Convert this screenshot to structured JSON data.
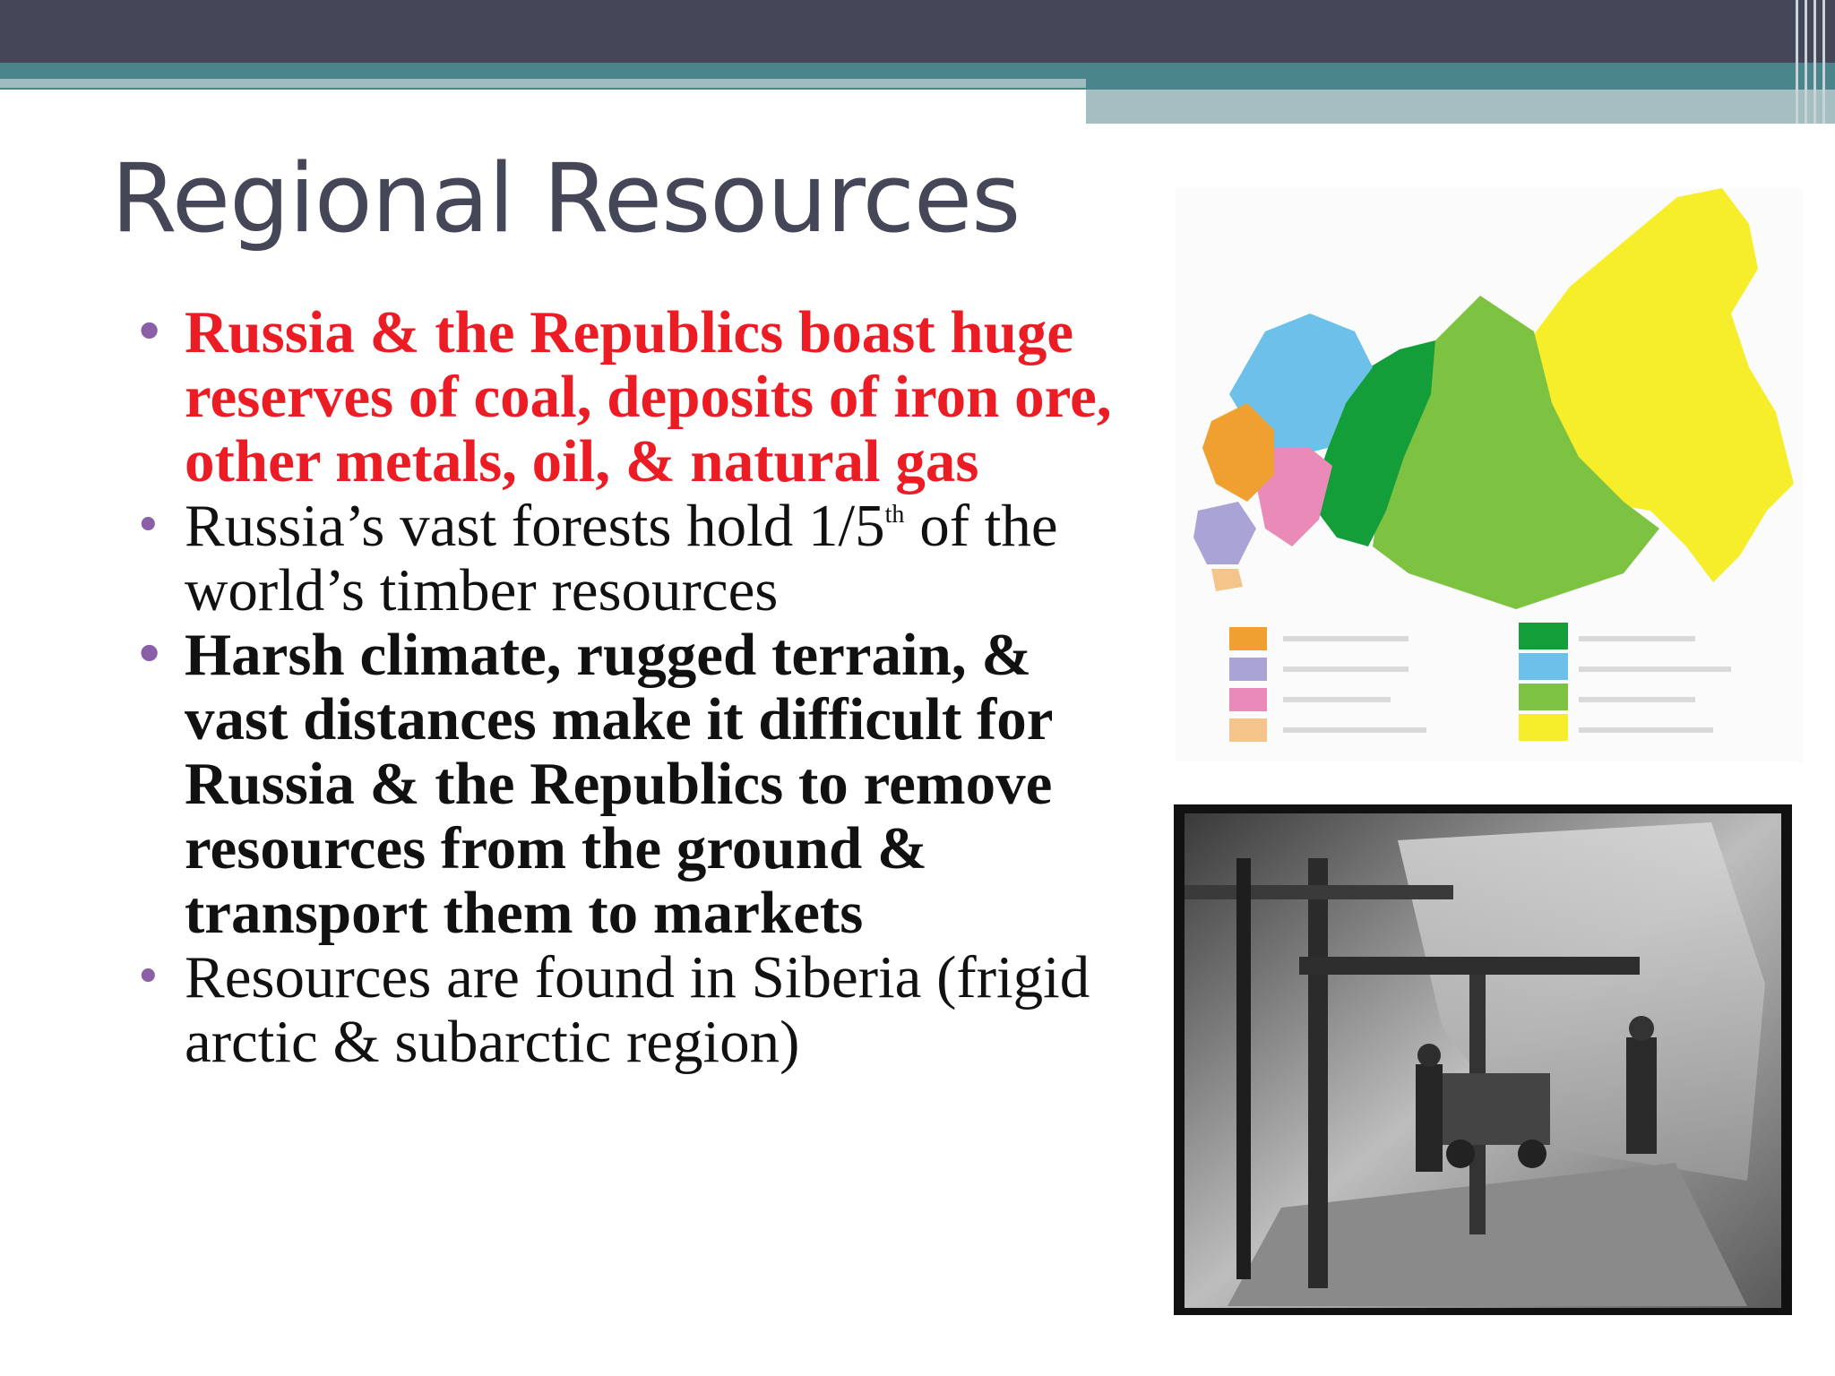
{
  "slide": {
    "title": "Regional Resources",
    "bullets": [
      {
        "text": "Russia & the Republics boast huge reserves of coal, deposits of iron ore, other metals, oil, & natural gas"
      },
      {
        "pre": "Russia’s vast forests hold 1/5",
        "sup": "th",
        "post": " of the world’s timber resources"
      },
      {
        "text": "Harsh climate, rugged terrain, & vast distances make it difficult for Russia & the Republics to remove resources from the ground & transport them to markets"
      },
      {
        "text": "Resources are found in Siberia (frigid arctic & subarctic region)"
      }
    ]
  },
  "colors": {
    "title": "#454658",
    "bullet_marker": "#8b5fa7",
    "emphasis_red": "#ec1c24",
    "header_dark": "#454658",
    "header_teal": "#4a858b",
    "header_light": "#a4bec2"
  },
  "map": {
    "region_colors": [
      "#f0a030",
      "#a9a3d6",
      "#e98ab8",
      "#f5c48a",
      "#139e3a",
      "#6cc0ea",
      "#7ec242",
      "#f6ee2a"
    ]
  }
}
